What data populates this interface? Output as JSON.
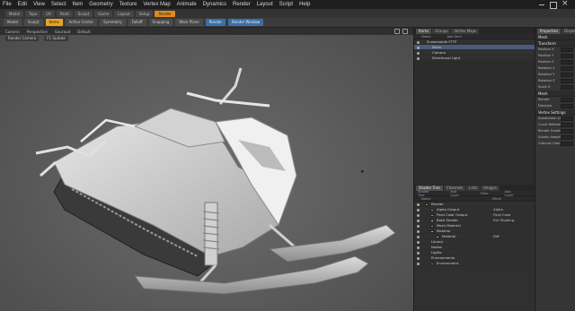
{
  "menu": [
    "File",
    "Edit",
    "View",
    "Select",
    "Item",
    "Geometry",
    "Texture",
    "Vertex Map",
    "Animate",
    "Dynamics",
    "Render",
    "Layout",
    "Script",
    "Help"
  ],
  "layout_tabs": [
    {
      "label": "Model",
      "active": false
    },
    {
      "label": "Topo",
      "active": false
    },
    {
      "label": "UV",
      "active": false
    },
    {
      "label": "Paint",
      "active": false
    },
    {
      "label": "Sculpt",
      "active": false
    },
    {
      "label": "Game",
      "active": false
    },
    {
      "label": "Layout",
      "active": false
    },
    {
      "label": "Setup",
      "active": false
    },
    {
      "label": "Render",
      "active": true
    }
  ],
  "toolbar": {
    "items": [
      {
        "label": "Model",
        "style": "normal"
      },
      {
        "label": "Sculpt",
        "style": "normal"
      },
      {
        "label": "Items",
        "style": "accent"
      },
      {
        "label": "Action Center",
        "style": "normal"
      },
      {
        "label": "Symmetry",
        "style": "normal"
      },
      {
        "label": "Falloff",
        "style": "normal"
      },
      {
        "label": "Snapping",
        "style": "normal"
      },
      {
        "label": "Work Plane",
        "style": "normal"
      },
      {
        "label": "Render",
        "style": "blue"
      },
      {
        "label": "Render Window",
        "style": "blue"
      }
    ]
  },
  "viewport": {
    "header": [
      "Camera",
      "Perspective",
      "Gouraud",
      "Default"
    ],
    "subheader": [
      "Render Camera",
      "F1 Update"
    ]
  },
  "items_panel": {
    "tabs": [
      {
        "label": "Items",
        "active": true
      },
      {
        "label": "Groups",
        "active": false
      },
      {
        "label": "Vertex Maps",
        "active": false
      }
    ],
    "columns": [
      "Name",
      "Add Item"
    ],
    "rows": [
      {
        "label": "Snowmobile FTTP",
        "indent": 0,
        "selected": false
      },
      {
        "label": "Mesh",
        "indent": 1,
        "selected": true
      },
      {
        "label": "Camera",
        "indent": 1,
        "selected": false
      },
      {
        "label": "Directional Light",
        "indent": 1,
        "selected": false
      }
    ]
  },
  "shader_panel": {
    "tabs": [
      {
        "label": "Shader Tree",
        "active": true
      },
      {
        "label": "Channels",
        "active": false
      },
      {
        "label": "Lists",
        "active": false
      },
      {
        "label": "Images",
        "active": false
      }
    ],
    "toolbar": [
      "Shader Tree",
      "Add Layer",
      "Filter",
      "Add Layer"
    ],
    "columns": [
      "Name",
      "Effect"
    ],
    "rows": [
      {
        "label": "Render",
        "indent": 0,
        "swatch": "#e08a1e",
        "effect": ""
      },
      {
        "label": "Alpha Output",
        "indent": 1,
        "swatch": "#9a9a9a",
        "effect": "Alpha"
      },
      {
        "label": "Final Color Output",
        "indent": 1,
        "swatch": "#9a9a9a",
        "effect": "Final Color"
      },
      {
        "label": "Base Shader",
        "indent": 1,
        "swatch": "#cfcfcf",
        "effect": "Full Shading"
      },
      {
        "label": "Mesh Material",
        "indent": 1,
        "swatch": "#7a8fb0",
        "effect": ""
      },
      {
        "label": "Material",
        "indent": 1,
        "swatch": "#b8b8b8",
        "effect": ""
      },
      {
        "label": "Material",
        "indent": 2,
        "swatch": "#b8b8b8",
        "effect": "Diff"
      },
      {
        "label": "Library",
        "indent": 0,
        "swatch": "",
        "effect": ""
      },
      {
        "label": "Nodes",
        "indent": 0,
        "swatch": "",
        "effect": ""
      },
      {
        "label": "Lights",
        "indent": 0,
        "swatch": "",
        "effect": ""
      },
      {
        "label": "Environments",
        "indent": 0,
        "swatch": "",
        "effect": ""
      },
      {
        "label": "Environment",
        "indent": 1,
        "swatch": "#8a8a8a",
        "effect": ""
      }
    ]
  },
  "properties": {
    "tabs": [
      "Properties",
      "Display"
    ],
    "header": "Mesh",
    "sections": [
      {
        "title": "Transform",
        "rows": [
          "Position X",
          "Position Y",
          "Position Z",
          "Rotation X",
          "Rotation Y",
          "Rotation Z",
          "Scale X"
        ]
      },
      {
        "title": "Mesh",
        "rows": [
          "Render",
          "Dissolve"
        ]
      },
      {
        "title": "Vertex Settings",
        "rows": [
          "Subdivision Level",
          "Curve Refinement",
          "Render Subdiv",
          "Subdiv Adaptive",
          "Catmull-Clark"
        ]
      }
    ]
  }
}
